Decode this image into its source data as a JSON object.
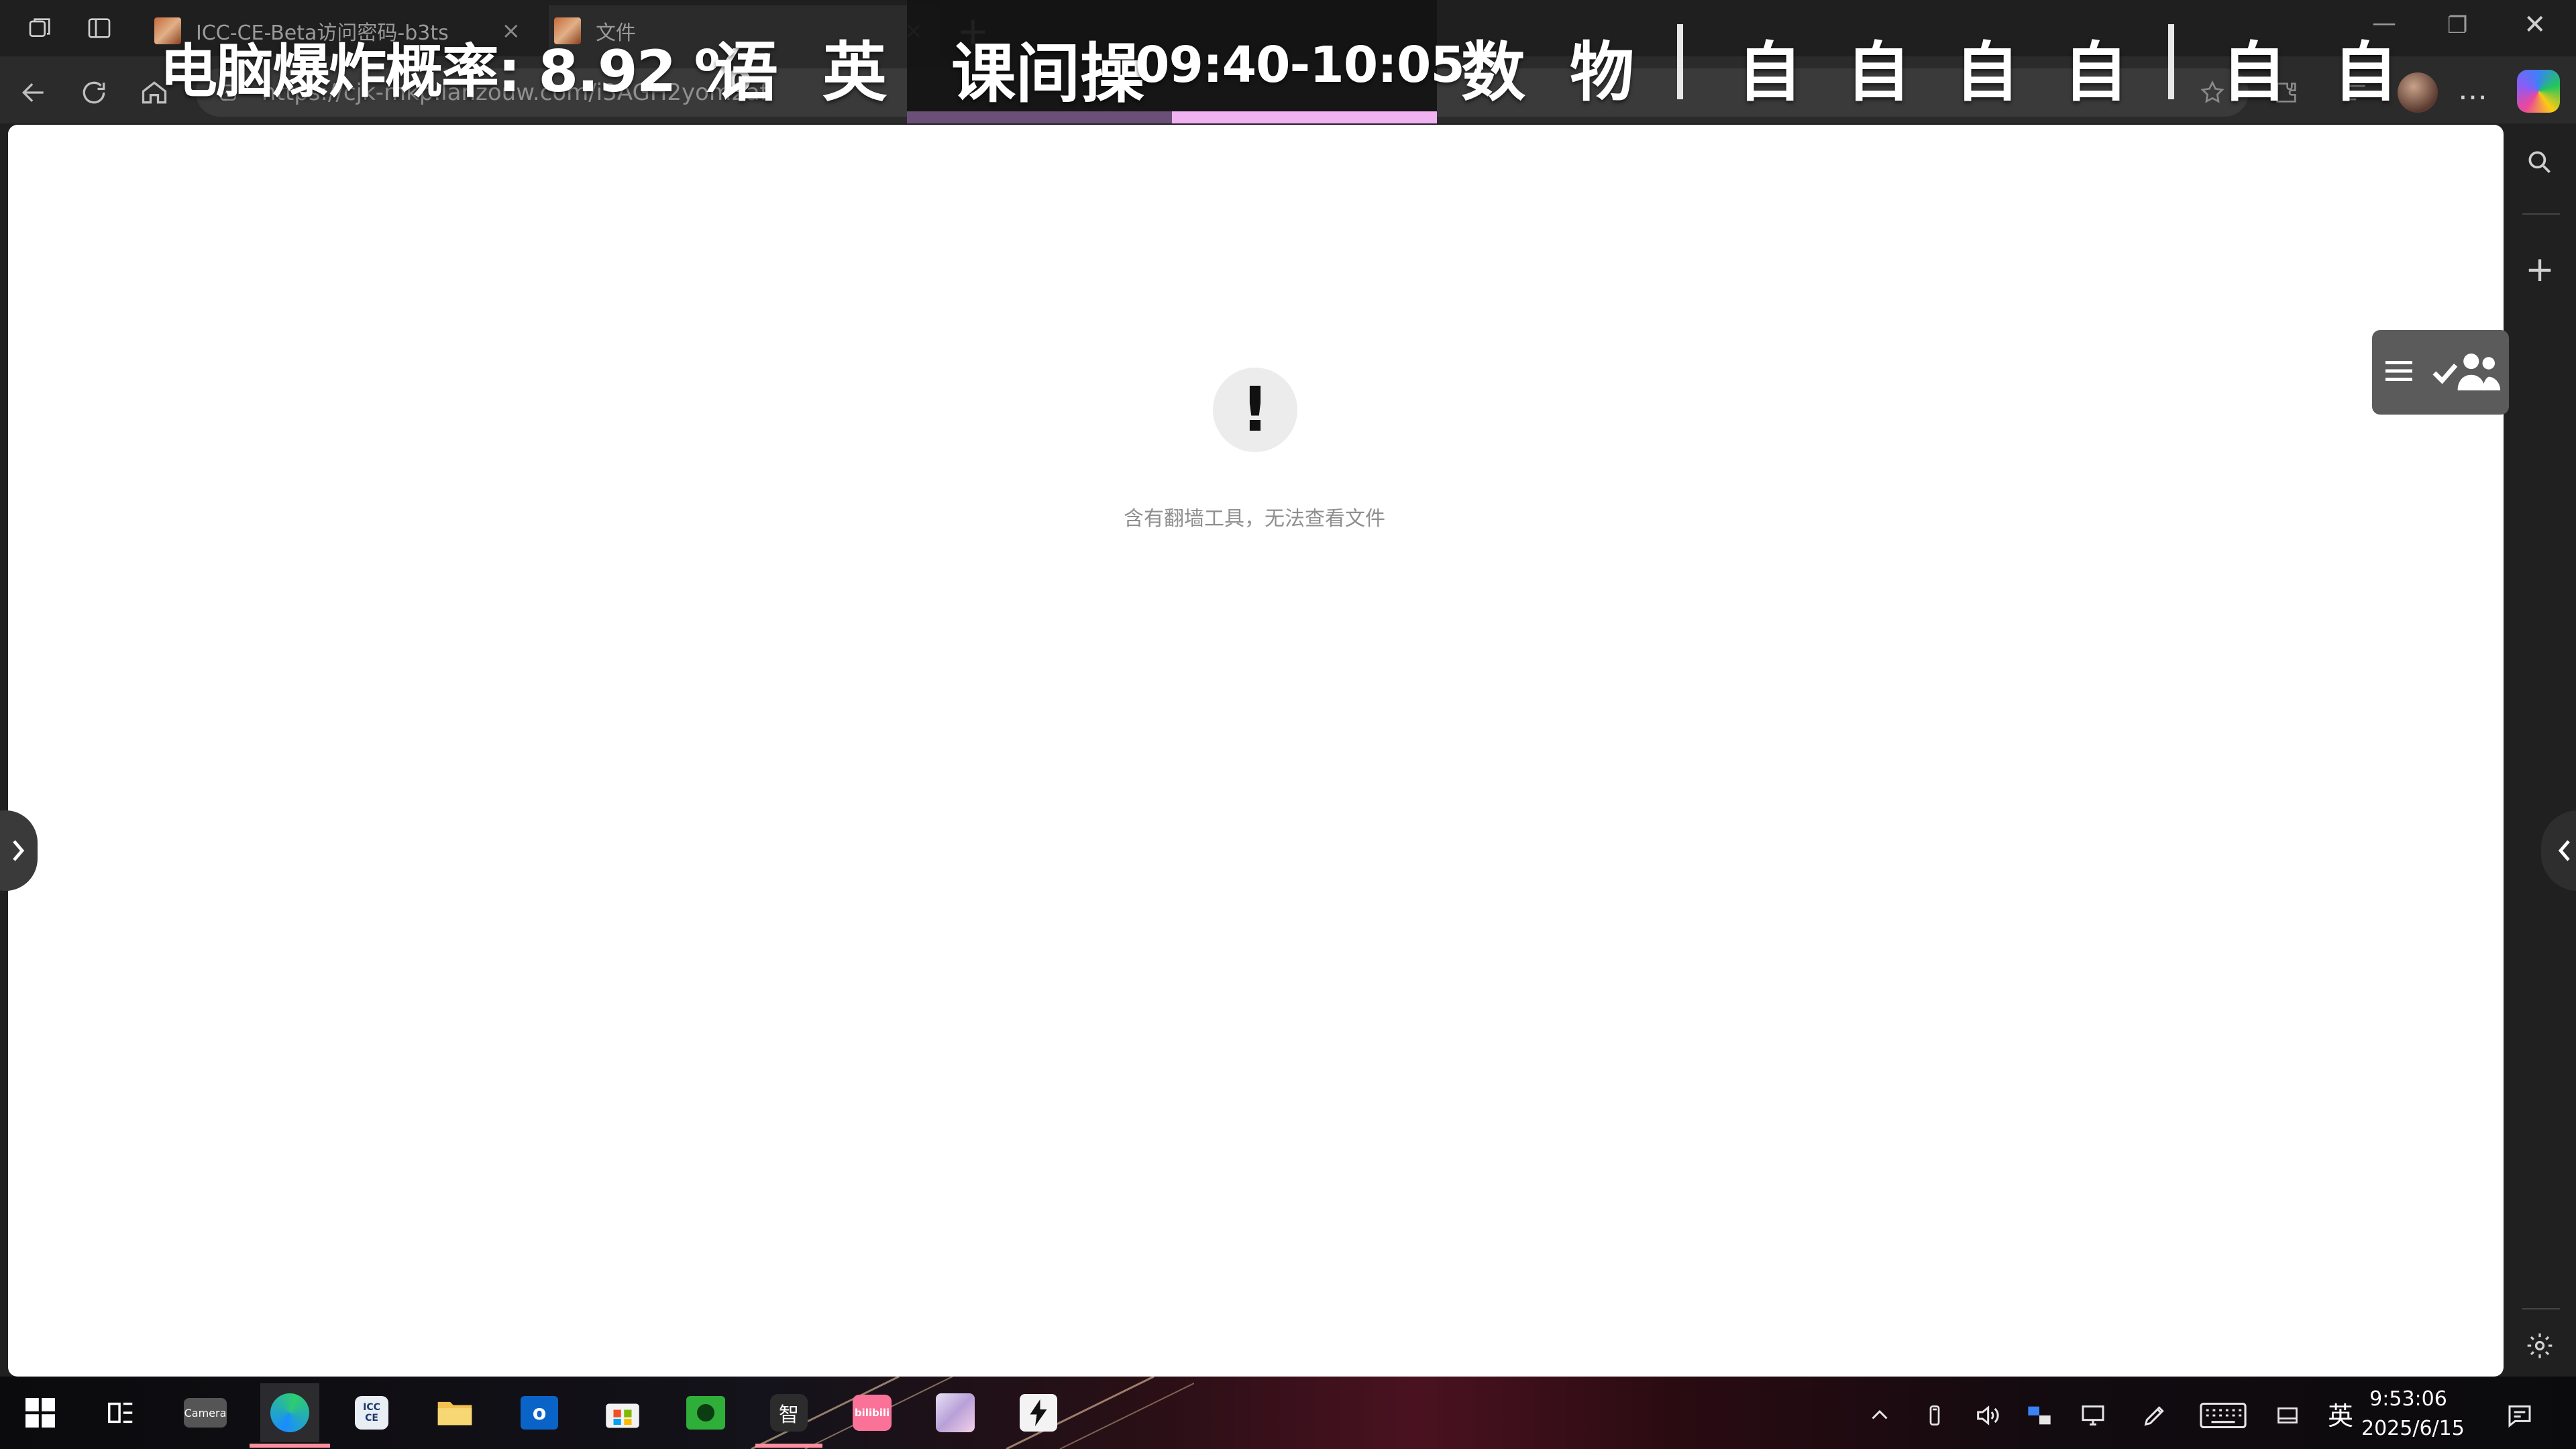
{
  "browser": {
    "tabs": [
      {
        "title": "ICC-CE-Beta访问密码-b3ts"
      },
      {
        "title": "文件"
      }
    ],
    "address": "https://cjk-mkp.lanzouw.com/i3AGH2yom2af"
  },
  "overlay": {
    "crash_label": "电脑爆炸概率: 8.92 %",
    "subjects_before": [
      "语",
      "英"
    ],
    "current": {
      "subject": "课间操",
      "time": "09:40-10:05",
      "progress": 0.5
    },
    "subjects_after": [
      "数",
      "物"
    ],
    "self_study_group1": [
      "自",
      "自",
      "自",
      "自"
    ],
    "self_study_group2": [
      "自",
      "自"
    ]
  },
  "page": {
    "error_symbol": "!",
    "error_message": "含有翻墙工具，无法查看文件"
  },
  "taskbar": {
    "apps": [
      {
        "name": "start",
        "label": ""
      },
      {
        "name": "task-view",
        "label": ""
      },
      {
        "name": "camera",
        "label": "Camera"
      },
      {
        "name": "edge",
        "label": ""
      },
      {
        "name": "icc",
        "label": "ICC CE"
      },
      {
        "name": "explorer",
        "label": ""
      },
      {
        "name": "outlook",
        "label": ""
      },
      {
        "name": "store",
        "label": ""
      },
      {
        "name": "green-app",
        "label": ""
      },
      {
        "name": "zhi",
        "label": "智"
      },
      {
        "name": "bilibili",
        "label": "bilibili"
      },
      {
        "name": "anime-app",
        "label": ""
      },
      {
        "name": "zap-app",
        "label": ""
      }
    ],
    "ime": "英",
    "time": "9:53:06",
    "date": "2025/6/15"
  },
  "colors": {
    "progress_fill": "#f1b2f2",
    "progress_track": "#6a4f78",
    "overlay_current_bg": "#141414"
  }
}
